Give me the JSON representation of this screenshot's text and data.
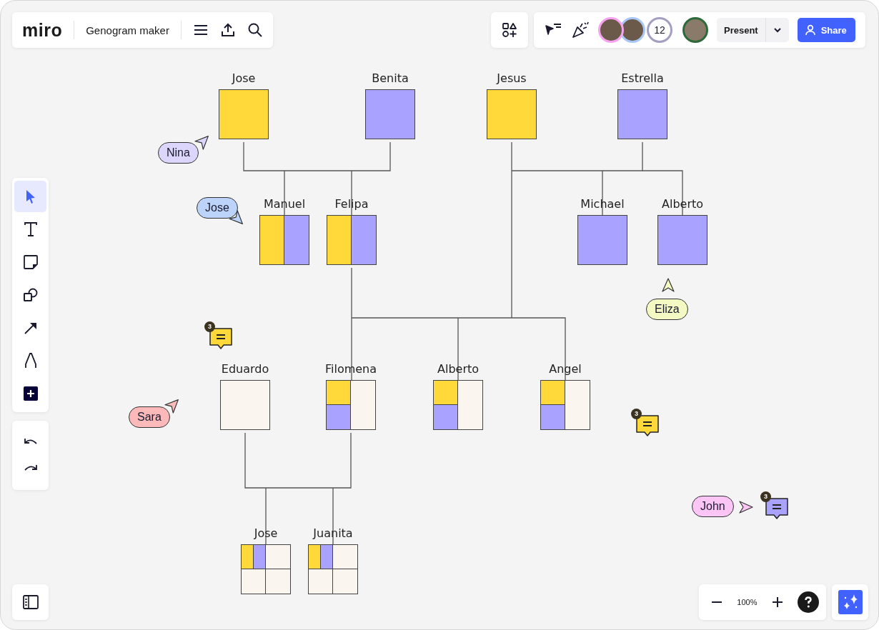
{
  "board": {
    "logo": "miro",
    "title": "Genogram maker"
  },
  "collaborators": [
    {
      "color": "#f5a3ee"
    },
    {
      "color": "#a8c7f7"
    }
  ],
  "collaborator_count": "12",
  "presenter": {
    "color": "#2c6a3a"
  },
  "present_button": "Present",
  "share_button": "Share",
  "tools": [
    {
      "kind": "select",
      "selected": true
    },
    {
      "kind": "text",
      "selected": false
    },
    {
      "kind": "sticky",
      "selected": false
    },
    {
      "kind": "shapes",
      "selected": false
    },
    {
      "kind": "arrow",
      "selected": false
    },
    {
      "kind": "pen",
      "selected": false
    },
    {
      "kind": "add",
      "selected": false
    }
  ],
  "zoom": {
    "reading": "100%"
  },
  "people": [
    {
      "name": "Jose",
      "kind": "yellow"
    },
    {
      "name": "Benita",
      "kind": "purple"
    },
    {
      "name": "Jesus",
      "kind": "yellow"
    },
    {
      "name": "Estrella",
      "kind": "purple"
    },
    {
      "name": "Manuel",
      "kind": "split"
    },
    {
      "name": "Felipa",
      "kind": "split"
    },
    {
      "name": "Michael",
      "kind": "purple"
    },
    {
      "name": "Alberto",
      "kind": "purple"
    },
    {
      "name": "Eduardo",
      "kind": "empty"
    },
    {
      "name": "Filomena",
      "kind": "quarters"
    },
    {
      "name": "Alberto",
      "kind": "quarters"
    },
    {
      "name": "Angel",
      "kind": "quarters"
    },
    {
      "name": "Jose",
      "kind": "strips"
    },
    {
      "name": "Juanita",
      "kind": "strips"
    }
  ],
  "cursors": [
    {
      "name": "Nina",
      "color": "#dcd6fc"
    },
    {
      "name": "Jose",
      "color": "#bcd3fa"
    },
    {
      "name": "Eliza",
      "color": "#f4f9c4"
    },
    {
      "name": "Sara",
      "color": "#fbb9b9"
    },
    {
      "name": "John",
      "color": "#fbc5f6"
    }
  ],
  "comments": [
    {
      "count": "3",
      "color": "#ffd83a"
    },
    {
      "count": "3",
      "color": "#ffd83a"
    },
    {
      "count": "3",
      "color": "#aaa2ff"
    }
  ]
}
